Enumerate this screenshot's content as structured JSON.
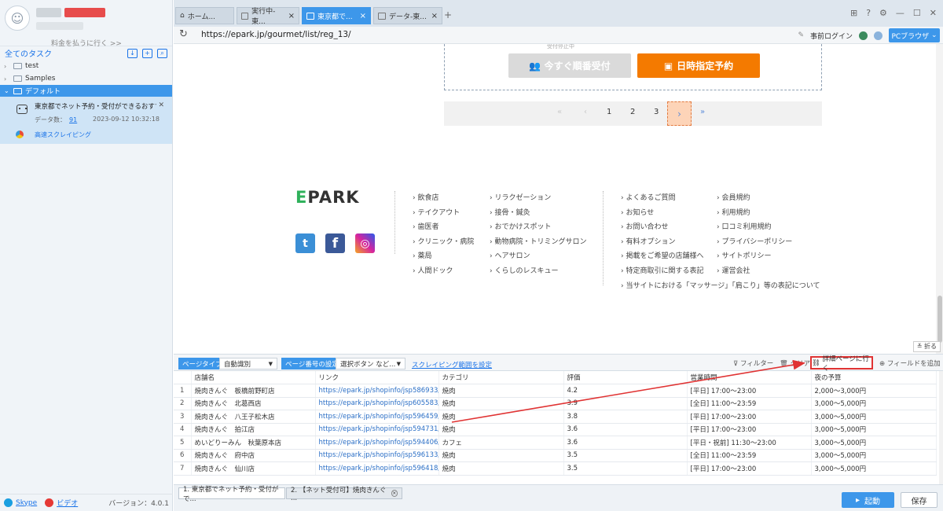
{
  "sidebar": {
    "pay_link": "料金を払うに行く >>",
    "all_tasks": "全てのタスク",
    "tree": [
      {
        "label": "test"
      },
      {
        "label": "Samples"
      },
      {
        "label": "デフォルト"
      }
    ],
    "task": {
      "name": "東京都でネット予約・受付ができるおすすめ...",
      "data_count_label": "データ数：",
      "data_count": "91",
      "date": "2023-09-12 10:32:18",
      "mode": "高速スクレイピング"
    },
    "footer": {
      "skype": "Skype",
      "video": "ビデオ",
      "version": "バージョン：4.0.1"
    }
  },
  "tabs": [
    {
      "label": "ホーム..."
    },
    {
      "label": "実行中-東..."
    },
    {
      "label": "東京都で..."
    },
    {
      "label": "データ-東..."
    }
  ],
  "address": {
    "url": "https://epark.jp/gourmet/list/reg_13/",
    "login": "事前ログイン",
    "browser": "PCブラウザ"
  },
  "web": {
    "reception_small": "受付停止中",
    "btn_now": "今すぐ順番受付",
    "btn_reserve": "日時指定予約",
    "pager": {
      "first": "«",
      "prev": "‹",
      "pages": [
        "1",
        "2",
        "3"
      ],
      "next": "›",
      "last": "»"
    },
    "logo_e": "E",
    "logo_rest": "PARK",
    "social": {
      "twitter": "t",
      "facebook": "f",
      "instagram": "◎"
    },
    "col1": [
      "› 飲食店",
      "› テイクアウト",
      "› 歯医者",
      "› クリニック・病院",
      "› 薬局",
      "› 人間ドック"
    ],
    "col2": [
      "› リラクゼーション",
      "› 接骨・鍼灸",
      "› おでかけスポット",
      "› 動物病院・トリミングサロン",
      "› ヘアサロン",
      "› くらしのレスキュー"
    ],
    "col3": [
      "› よくあるご質問",
      "› お知らせ",
      "› お問い合わせ",
      "› 有料オプション",
      "› 掲載をご希望の店舗様へ",
      "› 特定商取引に関する表記",
      "› 当サイトにおける「マッサージ」「肩こり」等の表記について"
    ],
    "col4": [
      "› 会員規約",
      "› 利用規約",
      "› 口コミ利用規約",
      "› プライバシーポリシー",
      "› サイトポリシー",
      "› 運営会社"
    ],
    "fold": "折る"
  },
  "toolbar": {
    "page_type_label": "ページタイプ",
    "page_type_value": "自動識別",
    "page_num_label": "ページ番号の設定",
    "page_num_value": "選択ボタン など...",
    "range_link": "スクレイピング範囲を設定",
    "filter": "フィルター",
    "clear": "クリア",
    "detail": "詳細ページに行く",
    "add_field": "フィールドを追加"
  },
  "table": {
    "headers": [
      "",
      "店舗名",
      "リンク",
      "カテゴリ",
      "評価",
      "営業時間",
      "夜の予算"
    ],
    "rows": [
      [
        "1",
        "焼肉きんぐ　板橋前野町店",
        "https://epark.jp/shopinfo/jsp586933/",
        "焼肉",
        "4.2",
        "[平日] 17:00～23:00",
        "2,000～3,000円"
      ],
      [
        "2",
        "焼肉きんぐ　北葛西店",
        "https://epark.jp/shopinfo/jsp605583/",
        "焼肉",
        "3.9",
        "[全日] 11:00～23:59",
        "3,000～5,000円"
      ],
      [
        "3",
        "焼肉きんぐ　八王子松木店",
        "https://epark.jp/shopinfo/jsp596459/",
        "焼肉",
        "3.8",
        "[平日] 17:00～23:00",
        "3,000～5,000円"
      ],
      [
        "4",
        "焼肉きんぐ　拍江店",
        "https://epark.jp/shopinfo/jsp594731/",
        "焼肉",
        "3.6",
        "[平日] 17:00～23:00",
        "3,000～5,000円"
      ],
      [
        "5",
        "めいどりーみん　秋葉原本店",
        "https://epark.jp/shopinfo/jsp594406/",
        "カフェ",
        "3.6",
        "[平日・祝前] 11:30～23:00",
        "3,000～5,000円"
      ],
      [
        "6",
        "焼肉きんぐ　府中店",
        "https://epark.jp/shopinfo/jsp596133/",
        "焼肉",
        "3.5",
        "[全日] 11:00～23:59",
        "3,000～5,000円"
      ],
      [
        "7",
        "焼肉きんぐ　仙川店",
        "https://epark.jp/shopinfo/jsp596418/",
        "焼肉",
        "3.5",
        "[平日] 17:00～23:00",
        "3,000～5,000円"
      ]
    ]
  },
  "bottom": {
    "tab1": "1. 東京都でネット予約・受付がで...",
    "tab2": "2. 【ネット受付可】焼肉きんぐ ...",
    "start": "起動",
    "save": "保存"
  },
  "colors": {
    "accent": "#3d97ea",
    "orange": "#f47a00",
    "annotation": "#e03333"
  }
}
